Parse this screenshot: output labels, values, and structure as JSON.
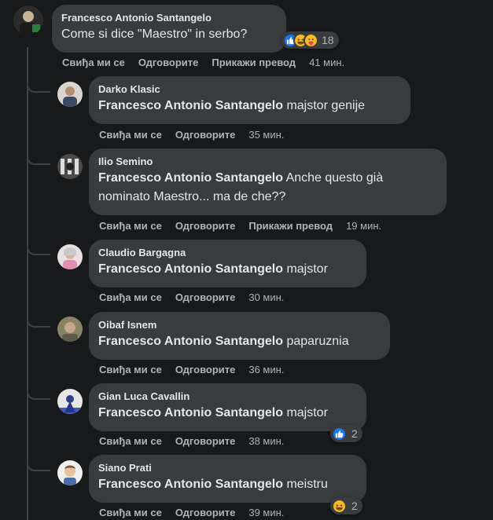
{
  "root_comment": {
    "author": "Francesco Antonio Santangelo",
    "text": "Come si dice \"Maestro\" in serbo?",
    "reaction_count": "18",
    "actions": {
      "like": "Свиђа ми се",
      "reply": "Одговорите",
      "translate": "Прикажи превод",
      "time": "41 мин."
    }
  },
  "labels": {
    "like": "Свиђа ми се",
    "reply": "Одговорите",
    "translate": "Прикажи превод"
  },
  "replies": [
    {
      "author": "Darko Klasic",
      "mention": "Francesco Antonio Santangelo",
      "text": " majstor genije",
      "time": "35 мин."
    },
    {
      "author": "Ilio Semino",
      "mention": "Francesco Antonio Santangelo",
      "text": " Anche questo già nominato Maestro... ma de che??",
      "time": "19 мин."
    },
    {
      "author": "Claudio Bargagna",
      "mention": "Francesco Antonio Santangelo",
      "text": " majstor",
      "time": "30 мин."
    },
    {
      "author": "Oibaf Isnem",
      "mention": "Francesco Antonio Santangelo",
      "text": " paparuznia",
      "time": "36 мин."
    },
    {
      "author": "Gian Luca Cavallin",
      "mention": "Francesco Antonio Santangelo",
      "text": " majstor",
      "time": "38 мин.",
      "reaction_count": "2"
    },
    {
      "author": "Siano Prati",
      "mention": "Francesco Antonio Santangelo",
      "text": " meistru",
      "time": "39 мин.",
      "reaction_count": "2"
    }
  ],
  "colors": {
    "background": "#18191a",
    "bubble": "#3a3b3c",
    "primary_text": "#e4e6eb",
    "secondary_text": "#b0b3b8",
    "like_blue": "#1877f2",
    "haha_yellow": "#f7b928",
    "love_red": "#f33e58"
  },
  "icons": [
    "like-reaction-icon",
    "haha-reaction-icon",
    "care-reaction-icon"
  ]
}
